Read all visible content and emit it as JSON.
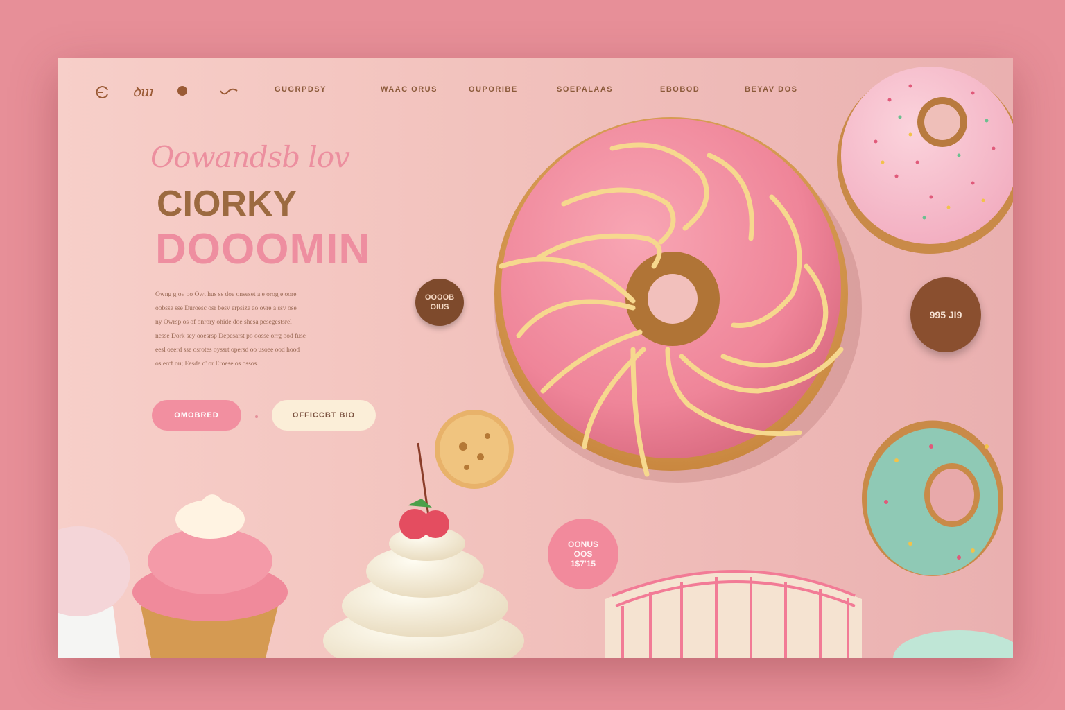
{
  "nav": {
    "icons": [
      "swirl-icon",
      "script-logo-icon",
      "dot-icon",
      "wave-icon"
    ],
    "logo_text": "ꝺɯ",
    "links": [
      "GUGRPDSY",
      "WAAC ORUS",
      "OUPORIBE",
      "SOEPALAAS",
      "EBOBOD",
      "BEYAV DOS"
    ]
  },
  "hero": {
    "script_title": "Oowandsb lov",
    "title_line1": "CIORKY",
    "title_line2": "DOOOMIN",
    "paragraph": [
      "Owng g ov oo Owt hus ss doe onseset a e orog e oore",
      "oobsse sse Duroesc osr besv erpsize ao ovre a ssv ose",
      "ny Owrsp os of onrory ohide doe shesa pesegestsrel",
      "nesse Dork sey ooesrsp Depesarst po oosse orrg ood fuse",
      "eesl oeerd sse osrotes oyssrt opersd oo usoee ood hood",
      "os ercf ou; Eesde o' or Eroese os ossos."
    ],
    "primary_button": "OMOBRED",
    "secondary_button": "OFFICCBT BIO"
  },
  "badges": {
    "small_left": [
      "OOOOB",
      "OIUS"
    ],
    "right": "995 JI9",
    "pink": [
      "OONUS",
      "OOS",
      "1$7'15"
    ]
  },
  "colors": {
    "frame": "#e78f98",
    "page_bg": "#f4c8c2",
    "accent_pink": "#ee8ea0",
    "brown": "#9c6a40"
  }
}
